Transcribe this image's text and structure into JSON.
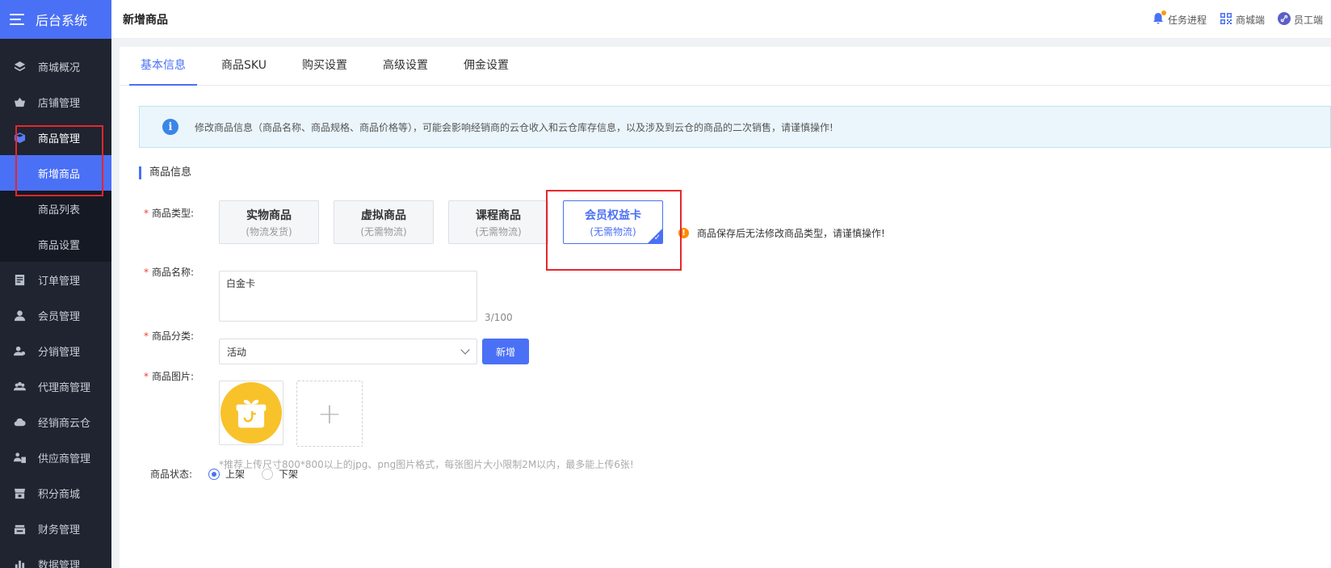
{
  "app": {
    "name": "后台系统"
  },
  "sidebar": {
    "items": [
      {
        "label": "商城概况",
        "icon": "layers-icon"
      },
      {
        "label": "店铺管理",
        "icon": "basket-icon"
      },
      {
        "label": "商品管理",
        "icon": "cube-icon",
        "open": true
      }
    ],
    "submenu": [
      {
        "label": "新增商品",
        "active": true
      },
      {
        "label": "商品列表"
      },
      {
        "label": "商品设置"
      }
    ],
    "items_after": [
      {
        "label": "订单管理",
        "icon": "document-icon"
      },
      {
        "label": "会员管理",
        "icon": "user-icon"
      },
      {
        "label": "分销管理",
        "icon": "share-users-icon"
      },
      {
        "label": "代理商管理",
        "icon": "group-icon"
      },
      {
        "label": "经销商云仓",
        "icon": "cloud-icon"
      },
      {
        "label": "供应商管理",
        "icon": "supplier-icon"
      },
      {
        "label": "积分商城",
        "icon": "store-icon"
      },
      {
        "label": "财务管理",
        "icon": "wallet-icon"
      },
      {
        "label": "数据管理",
        "icon": "bar-chart-icon"
      }
    ]
  },
  "header": {
    "title": "新增商品",
    "links": [
      {
        "label": "任务进程",
        "icon": "bell-icon"
      },
      {
        "label": "商城端",
        "icon": "qrcode-icon"
      },
      {
        "label": "员工端",
        "icon": "link-icon"
      }
    ]
  },
  "tabs": [
    "基本信息",
    "商品SKU",
    "购买设置",
    "高级设置",
    "佣金设置"
  ],
  "notice": "修改商品信息（商品名称、商品规格、商品价格等），可能会影响经销商的云仓收入和云仓库存信息，以及涉及到云仓的商品的二次销售，请谨慎操作!",
  "section_title": "商品信息",
  "form": {
    "type_label": "商品类型:",
    "types": [
      {
        "title": "实物商品",
        "sub": "(物流发货)"
      },
      {
        "title": "虚拟商品",
        "sub": "(无需物流)"
      },
      {
        "title": "课程商品",
        "sub": "(无需物流)"
      },
      {
        "title": "会员权益卡",
        "sub": "(无需物流)",
        "selected": true
      }
    ],
    "type_warning": "商品保存后无法修改商品类型，请谨慎操作!",
    "name_label": "商品名称:",
    "name_value": "白金卡",
    "name_count": "3/100",
    "category_label": "商品分类:",
    "category_value": "活动",
    "add_button": "新增",
    "image_label": "商品图片:",
    "image_hint": "*推荐上传尺寸800*800以上的jpg、png图片格式，每张图片大小限制2M以内，最多能上传6张!",
    "status_label": "商品状态:",
    "status_options": [
      {
        "label": "上架",
        "checked": true
      },
      {
        "label": "下架"
      }
    ]
  },
  "colors": {
    "accent": "#4a70f5",
    "sidebar_bg": "#1f2430",
    "highlight": "#e8262c",
    "warning": "#ff8a00"
  }
}
